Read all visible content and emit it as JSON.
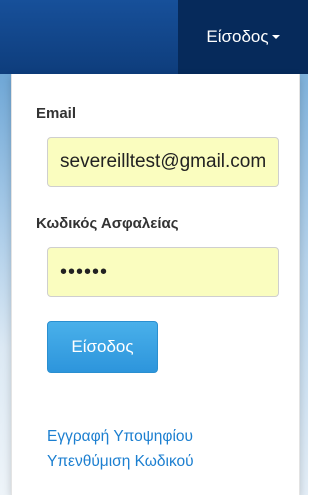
{
  "navbar": {
    "login_label": "Είσοδος"
  },
  "login_form": {
    "email_label": "Email",
    "email_value": "severeilltest@gmail.com",
    "password_label": "Κωδικός Ασφαλείας",
    "password_value": "severe",
    "submit_label": "Είσοδος"
  },
  "links": {
    "register": "Εγγραφή Υποψηφίου",
    "password_reminder": "Υπενθύμιση Κωδικού"
  }
}
